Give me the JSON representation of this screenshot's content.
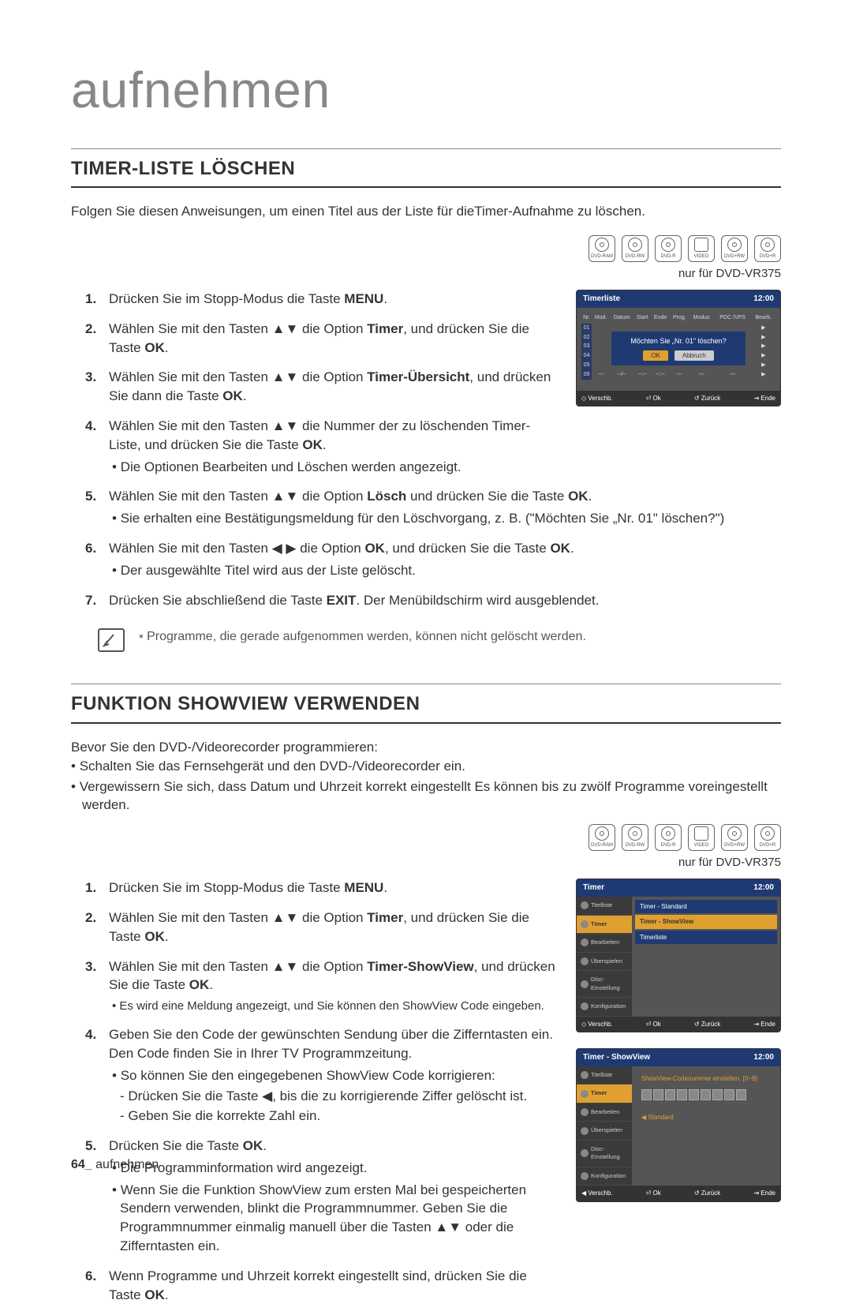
{
  "chapter": "aufnehmen",
  "section1": {
    "title": "TIMER-LISTE LÖSCHEN",
    "intro": "Folgen Sie diesen Anweisungen, um einen Titel aus der Liste für dieTimer-Aufnahme zu löschen.",
    "device_note": "nur für DVD-VR375",
    "discs": [
      "DVD-RAM",
      "DVD-RW",
      "DVD-R",
      "VIDEO",
      "DVD+RW",
      "DVD+R"
    ],
    "steps": [
      {
        "text": "Drücken Sie im Stopp-Modus die Taste ",
        "bold": "MENU",
        "suffix": "."
      },
      {
        "text": "Wählen Sie mit den Tasten ▲▼ die Option ",
        "bold": "Timer",
        "suffix": ", und drücken Sie die Taste ",
        "bold2": "OK",
        "suffix2": "."
      },
      {
        "text": "Wählen Sie mit den Tasten ▲▼ die Option ",
        "bold": "Timer-Übersicht",
        "suffix": ", und drücken Sie dann die Taste ",
        "bold2": "OK",
        "suffix2": "."
      },
      {
        "text": "Wählen Sie mit den Tasten ▲▼ die Nummer der zu löschenden Timer-Liste, und drücken Sie die Taste ",
        "bold": "OK",
        "suffix": ".",
        "sub": "Die Optionen Bearbeiten und Löschen werden angezeigt."
      },
      {
        "text": "Wählen Sie mit den Tasten ▲▼ die Option ",
        "bold": "Lösch",
        "suffix": " und drücken Sie die Taste ",
        "bold2": "OK",
        "suffix2": ".",
        "sub": "Sie erhalten eine Bestätigungsmeldung für den Löschvorgang, z. B. (\"Möchten Sie „Nr. 01\" löschen?\")"
      },
      {
        "text": "Wählen Sie mit den Tasten ◀ ▶ die Option ",
        "bold": "OK",
        "suffix": ", und drücken Sie die Taste ",
        "bold2": "OK",
        "suffix2": ".",
        "sub": "Der ausgewählte Titel wird aus der Liste gelöscht."
      },
      {
        "text": "Drücken Sie abschließend die Taste ",
        "bold": "EXIT",
        "suffix": ". Der Menübildschirm wird ausgeblendet."
      }
    ],
    "note": "Programme, die gerade aufgenommen werden, können nicht gelöscht werden.",
    "osd": {
      "title": "Timerliste",
      "clock": "12:00",
      "headers": [
        "Nr.",
        "Mod.",
        "Datum",
        "Start",
        "Ende",
        "Prog.",
        "Modus",
        "PDC /VPS",
        "Bearb."
      ],
      "rows": [
        "01",
        "02",
        "03",
        "04",
        "05",
        "06"
      ],
      "row_placeholder": [
        "---",
        "--/--",
        "--:--",
        "--:--",
        "---",
        "---",
        "---",
        "▶"
      ],
      "dialog": "Möchten Sie „Nr. 01\" löschen?",
      "dialog_ok": "OK",
      "dialog_cancel": "Abbruch",
      "foot": [
        "◇ Verschb.",
        "⏎ Ok",
        "↺ Zurück",
        "⇥ Ende"
      ]
    }
  },
  "section2": {
    "title": "FUNKTION SHOWVIEW VERWENDEN",
    "intro": "Bevor Sie den DVD-/Videorecorder programmieren:",
    "intro_bullets": [
      "Schalten Sie das Fernsehgerät und den DVD-/Videorecorder ein.",
      "Vergewissern Sie sich, dass Datum und Uhrzeit korrekt eingestellt Es können bis zu zwölf Programme voreingestellt werden."
    ],
    "device_note": "nur für DVD-VR375",
    "discs": [
      "DVD-RAM",
      "DVD-RW",
      "DVD-R",
      "VIDEO",
      "DVD+RW",
      "DVD+R"
    ],
    "steps": [
      {
        "text": "Drücken Sie im Stopp-Modus die Taste ",
        "bold": "MENU",
        "suffix": "."
      },
      {
        "text": "Wählen Sie mit den Tasten ▲▼ die Option ",
        "bold": "Timer",
        "suffix": ", und drücken Sie die Taste ",
        "bold2": "OK",
        "suffix2": "."
      },
      {
        "text": "Wählen Sie mit den Tasten ▲▼ die Option ",
        "bold": "Timer-ShowView",
        "suffix": ", und drücken Sie die Taste ",
        "bold2": "OK",
        "suffix2": ".",
        "sub": "Es wird eine Meldung angezeigt, und Sie können den ShowView Code eingeben."
      },
      {
        "text": "Geben Sie den Code der gewünschten Sendung über die Zifferntasten ein. Den Code finden Sie in Ihrer TV Programmzeitung.",
        "sub": "So können Sie den eingegebenen ShowView Code korrigieren:",
        "subdash1": "Drücken Sie die Taste ◀, bis die zu korrigierende Ziffer gelöscht ist.",
        "subdash2": "Geben Sie die korrekte Zahl ein."
      },
      {
        "text": "Drücken Sie die Taste ",
        "bold": "OK",
        "suffix": ".",
        "sub": "Die Programminformation wird angezeigt.",
        "sub2": "Wenn Sie die Funktion ShowView zum ersten Mal bei gespeicherten Sendern verwenden, blinkt die Programmnummer. Geben Sie die Programmnummer einmalig manuell über die Tasten ▲▼ oder die Zifferntasten ein."
      },
      {
        "text": "Wenn Programme und Uhrzeit korrekt eingestellt sind, drücken Sie die Taste ",
        "bold": "OK",
        "suffix": "."
      }
    ],
    "osd_a": {
      "title": "Timer",
      "clock": "12:00",
      "sidebar": [
        "Titelliste",
        "Timer",
        "Bearbeiten",
        "Überspielen",
        "Disc-Einstellung",
        "Konfiguration"
      ],
      "sidebar_selected": 1,
      "options": [
        "Timer - Standard",
        "Timer - ShowView",
        "Timerliste"
      ],
      "option_selected": 1,
      "foot": [
        "◇ Verschb.",
        "⏎ Ok",
        "↺ Zurück",
        "⇥ Ende"
      ]
    },
    "osd_b": {
      "title": "Timer - ShowView",
      "clock": "12:00",
      "sidebar": [
        "Titelliste",
        "Timer",
        "Bearbeiten",
        "Überspielen",
        "Disc-Einstellung",
        "Konfiguration"
      ],
      "sidebar_selected": 1,
      "prompt": "ShowView-Codenummer einstellen. [0~9]",
      "std": "Standard",
      "foot": [
        "◀ Verschb.",
        "⏎ Ok",
        "↺ Zurück",
        "⇥ Ende"
      ]
    }
  },
  "footer": {
    "page": "64_",
    "label": "aufnehmen"
  }
}
